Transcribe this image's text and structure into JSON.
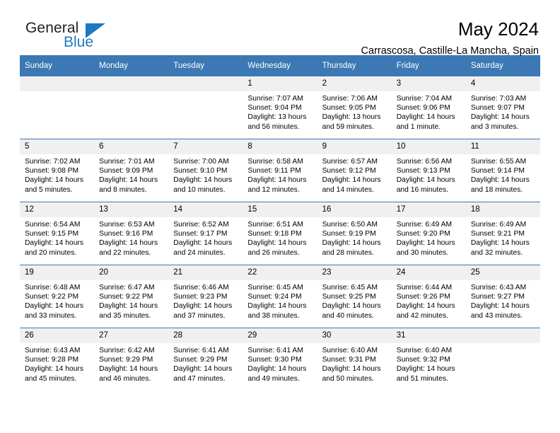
{
  "brand": {
    "name_part1": "General",
    "name_part2": "Blue",
    "triangle_color": "#1f79c0"
  },
  "header": {
    "title": "May 2024",
    "subtitle": "Carrascosa, Castille-La Mancha, Spain",
    "accent_color": "#3b78b4"
  },
  "weekdays": [
    "Sunday",
    "Monday",
    "Tuesday",
    "Wednesday",
    "Thursday",
    "Friday",
    "Saturday"
  ],
  "labels": {
    "sunrise": "Sunrise:",
    "sunset": "Sunset:",
    "daylight": "Daylight:"
  },
  "weeks": [
    [
      {
        "day": "",
        "empty": true
      },
      {
        "day": "",
        "empty": true
      },
      {
        "day": "",
        "empty": true
      },
      {
        "day": "1",
        "sunrise": "Sunrise: 7:07 AM",
        "sunset": "Sunset: 9:04 PM",
        "daylight1": "Daylight: 13 hours",
        "daylight2": "and 56 minutes."
      },
      {
        "day": "2",
        "sunrise": "Sunrise: 7:06 AM",
        "sunset": "Sunset: 9:05 PM",
        "daylight1": "Daylight: 13 hours",
        "daylight2": "and 59 minutes."
      },
      {
        "day": "3",
        "sunrise": "Sunrise: 7:04 AM",
        "sunset": "Sunset: 9:06 PM",
        "daylight1": "Daylight: 14 hours",
        "daylight2": "and 1 minute."
      },
      {
        "day": "4",
        "sunrise": "Sunrise: 7:03 AM",
        "sunset": "Sunset: 9:07 PM",
        "daylight1": "Daylight: 14 hours",
        "daylight2": "and 3 minutes."
      }
    ],
    [
      {
        "day": "5",
        "sunrise": "Sunrise: 7:02 AM",
        "sunset": "Sunset: 9:08 PM",
        "daylight1": "Daylight: 14 hours",
        "daylight2": "and 5 minutes."
      },
      {
        "day": "6",
        "sunrise": "Sunrise: 7:01 AM",
        "sunset": "Sunset: 9:09 PM",
        "daylight1": "Daylight: 14 hours",
        "daylight2": "and 8 minutes."
      },
      {
        "day": "7",
        "sunrise": "Sunrise: 7:00 AM",
        "sunset": "Sunset: 9:10 PM",
        "daylight1": "Daylight: 14 hours",
        "daylight2": "and 10 minutes."
      },
      {
        "day": "8",
        "sunrise": "Sunrise: 6:58 AM",
        "sunset": "Sunset: 9:11 PM",
        "daylight1": "Daylight: 14 hours",
        "daylight2": "and 12 minutes."
      },
      {
        "day": "9",
        "sunrise": "Sunrise: 6:57 AM",
        "sunset": "Sunset: 9:12 PM",
        "daylight1": "Daylight: 14 hours",
        "daylight2": "and 14 minutes."
      },
      {
        "day": "10",
        "sunrise": "Sunrise: 6:56 AM",
        "sunset": "Sunset: 9:13 PM",
        "daylight1": "Daylight: 14 hours",
        "daylight2": "and 16 minutes."
      },
      {
        "day": "11",
        "sunrise": "Sunrise: 6:55 AM",
        "sunset": "Sunset: 9:14 PM",
        "daylight1": "Daylight: 14 hours",
        "daylight2": "and 18 minutes."
      }
    ],
    [
      {
        "day": "12",
        "sunrise": "Sunrise: 6:54 AM",
        "sunset": "Sunset: 9:15 PM",
        "daylight1": "Daylight: 14 hours",
        "daylight2": "and 20 minutes."
      },
      {
        "day": "13",
        "sunrise": "Sunrise: 6:53 AM",
        "sunset": "Sunset: 9:16 PM",
        "daylight1": "Daylight: 14 hours",
        "daylight2": "and 22 minutes."
      },
      {
        "day": "14",
        "sunrise": "Sunrise: 6:52 AM",
        "sunset": "Sunset: 9:17 PM",
        "daylight1": "Daylight: 14 hours",
        "daylight2": "and 24 minutes."
      },
      {
        "day": "15",
        "sunrise": "Sunrise: 6:51 AM",
        "sunset": "Sunset: 9:18 PM",
        "daylight1": "Daylight: 14 hours",
        "daylight2": "and 26 minutes."
      },
      {
        "day": "16",
        "sunrise": "Sunrise: 6:50 AM",
        "sunset": "Sunset: 9:19 PM",
        "daylight1": "Daylight: 14 hours",
        "daylight2": "and 28 minutes."
      },
      {
        "day": "17",
        "sunrise": "Sunrise: 6:49 AM",
        "sunset": "Sunset: 9:20 PM",
        "daylight1": "Daylight: 14 hours",
        "daylight2": "and 30 minutes."
      },
      {
        "day": "18",
        "sunrise": "Sunrise: 6:49 AM",
        "sunset": "Sunset: 9:21 PM",
        "daylight1": "Daylight: 14 hours",
        "daylight2": "and 32 minutes."
      }
    ],
    [
      {
        "day": "19",
        "sunrise": "Sunrise: 6:48 AM",
        "sunset": "Sunset: 9:22 PM",
        "daylight1": "Daylight: 14 hours",
        "daylight2": "and 33 minutes."
      },
      {
        "day": "20",
        "sunrise": "Sunrise: 6:47 AM",
        "sunset": "Sunset: 9:22 PM",
        "daylight1": "Daylight: 14 hours",
        "daylight2": "and 35 minutes."
      },
      {
        "day": "21",
        "sunrise": "Sunrise: 6:46 AM",
        "sunset": "Sunset: 9:23 PM",
        "daylight1": "Daylight: 14 hours",
        "daylight2": "and 37 minutes."
      },
      {
        "day": "22",
        "sunrise": "Sunrise: 6:45 AM",
        "sunset": "Sunset: 9:24 PM",
        "daylight1": "Daylight: 14 hours",
        "daylight2": "and 38 minutes."
      },
      {
        "day": "23",
        "sunrise": "Sunrise: 6:45 AM",
        "sunset": "Sunset: 9:25 PM",
        "daylight1": "Daylight: 14 hours",
        "daylight2": "and 40 minutes."
      },
      {
        "day": "24",
        "sunrise": "Sunrise: 6:44 AM",
        "sunset": "Sunset: 9:26 PM",
        "daylight1": "Daylight: 14 hours",
        "daylight2": "and 42 minutes."
      },
      {
        "day": "25",
        "sunrise": "Sunrise: 6:43 AM",
        "sunset": "Sunset: 9:27 PM",
        "daylight1": "Daylight: 14 hours",
        "daylight2": "and 43 minutes."
      }
    ],
    [
      {
        "day": "26",
        "sunrise": "Sunrise: 6:43 AM",
        "sunset": "Sunset: 9:28 PM",
        "daylight1": "Daylight: 14 hours",
        "daylight2": "and 45 minutes."
      },
      {
        "day": "27",
        "sunrise": "Sunrise: 6:42 AM",
        "sunset": "Sunset: 9:29 PM",
        "daylight1": "Daylight: 14 hours",
        "daylight2": "and 46 minutes."
      },
      {
        "day": "28",
        "sunrise": "Sunrise: 6:41 AM",
        "sunset": "Sunset: 9:29 PM",
        "daylight1": "Daylight: 14 hours",
        "daylight2": "and 47 minutes."
      },
      {
        "day": "29",
        "sunrise": "Sunrise: 6:41 AM",
        "sunset": "Sunset: 9:30 PM",
        "daylight1": "Daylight: 14 hours",
        "daylight2": "and 49 minutes."
      },
      {
        "day": "30",
        "sunrise": "Sunrise: 6:40 AM",
        "sunset": "Sunset: 9:31 PM",
        "daylight1": "Daylight: 14 hours",
        "daylight2": "and 50 minutes."
      },
      {
        "day": "31",
        "sunrise": "Sunrise: 6:40 AM",
        "sunset": "Sunset: 9:32 PM",
        "daylight1": "Daylight: 14 hours",
        "daylight2": "and 51 minutes."
      },
      {
        "day": "",
        "empty": true
      }
    ]
  ]
}
